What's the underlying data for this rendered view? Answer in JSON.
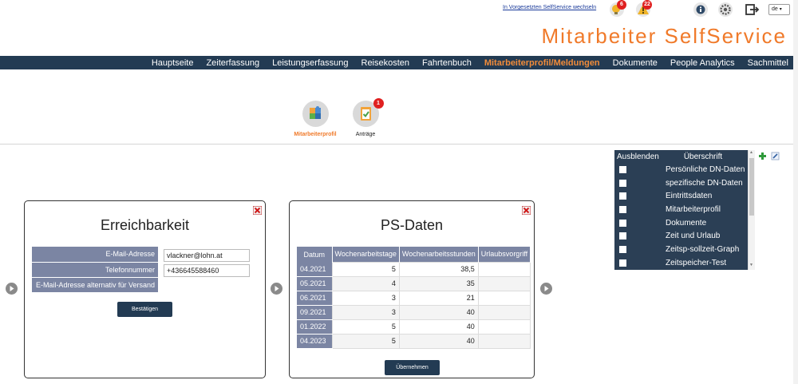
{
  "topbar": {
    "switch_link": "In Vorgesetzten SelfService wechseln",
    "badge_1": "6",
    "badge_2": "22",
    "lang": "de"
  },
  "app_title": "Mitarbeiter SelfService",
  "nav": [
    {
      "label": "Hauptseite",
      "active": false
    },
    {
      "label": "Zeiterfassung",
      "active": false
    },
    {
      "label": "Leistungserfassung",
      "active": false
    },
    {
      "label": "Reisekosten",
      "active": false
    },
    {
      "label": "Fahrtenbuch",
      "active": false
    },
    {
      "label": "Mitarbeiterprofil/Meldungen",
      "active": true
    },
    {
      "label": "Dokumente",
      "active": false
    },
    {
      "label": "People Analytics",
      "active": false
    },
    {
      "label": "Sachmittel",
      "active": false
    }
  ],
  "subnav": {
    "profile_label": "Mitarbeiterprofil",
    "requests_label": "Anträge",
    "requests_badge": "1"
  },
  "overview": {
    "col_hide": "Ausblenden",
    "col_title": "Überschrift",
    "items": [
      "Persönliche DN-Daten",
      "spezifische DN-Daten",
      "Eintrittsdaten",
      "Mitarbeiterprofil",
      "Dokumente",
      "Zeit und Urlaub",
      "Zeitsp-sollzeit-Graph",
      "Zeitspeicher-Test"
    ]
  },
  "contact": {
    "title": "Erreichbarkeit",
    "email_label": "E-Mail-Adresse",
    "email_value": "vlackner@lohn.at",
    "phone_label": "Telefonnummer",
    "phone_value": "+436645588460",
    "alt_label": "E-Mail-Adresse alternativ für Versand",
    "confirm_label": "Bestätigen"
  },
  "ps": {
    "title": "PS-Daten",
    "headers": [
      "Datum",
      "Wochenarbeitstage",
      "Wochenarbeitsstunden",
      "Urlaubsvorgriff"
    ],
    "rows": [
      [
        "04.2021",
        "5",
        "38,5",
        ""
      ],
      [
        "05.2021",
        "4",
        "35",
        ""
      ],
      [
        "06.2021",
        "3",
        "21",
        ""
      ],
      [
        "09.2021",
        "3",
        "40",
        ""
      ],
      [
        "01.2022",
        "5",
        "40",
        ""
      ],
      [
        "04.2023",
        "5",
        "40",
        ""
      ]
    ],
    "apply_label": "Übernehmen"
  },
  "icons": {
    "notify": "lightbulb-icon",
    "alert": "warning-icon",
    "info": "info-icon",
    "settings": "gear-icon",
    "logout": "logout-icon",
    "close": "close-icon",
    "arrow": "arrow-right-icon"
  },
  "colors": {
    "accent": "#f07a2a",
    "nav_bg": "#233b53",
    "table_header": "#7b85a3",
    "panel_bg": "#2b3f55"
  }
}
